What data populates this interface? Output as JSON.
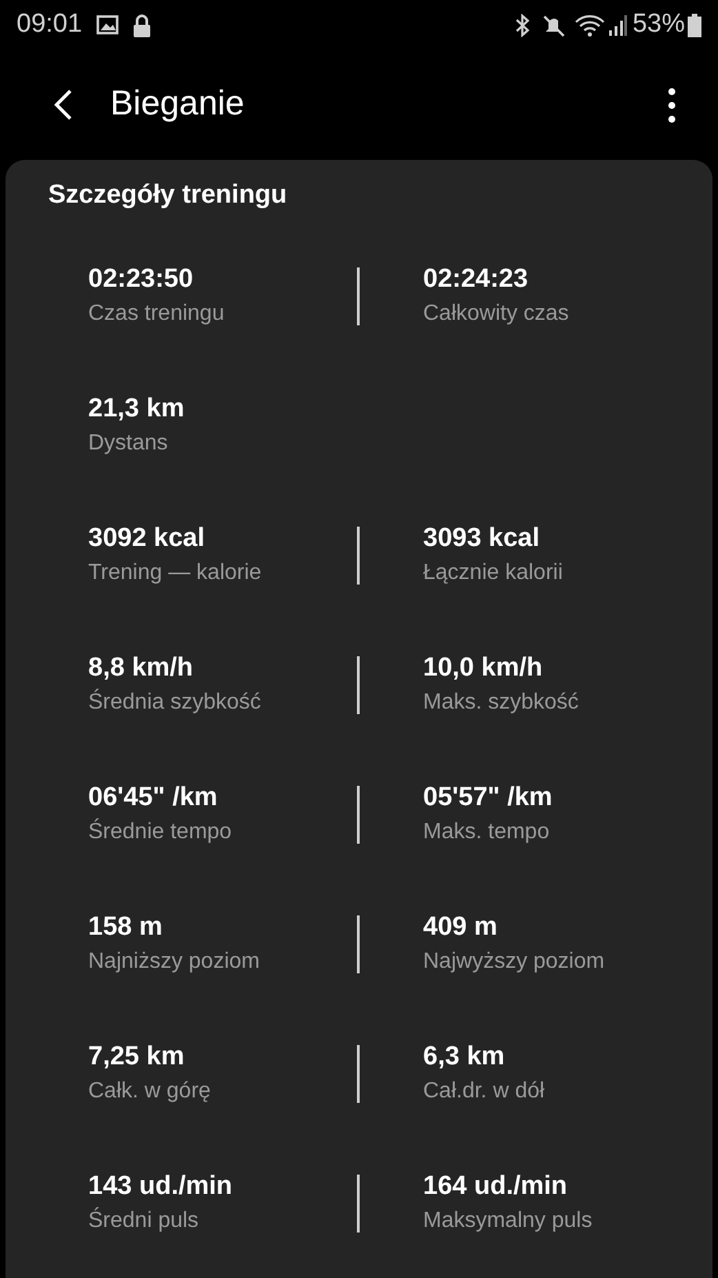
{
  "status_bar": {
    "time": "09:01",
    "battery": "53%"
  },
  "app_bar": {
    "title": "Bieganie"
  },
  "section": {
    "title": "Szczegóły treningu",
    "rows": [
      {
        "left": {
          "value": "02:23:50",
          "label": "Czas treningu"
        },
        "right": {
          "value": "02:24:23",
          "label": "Całkowity czas"
        }
      },
      {
        "left": {
          "value": "21,3 km",
          "label": "Dystans"
        }
      },
      {
        "left": {
          "value": "3092 kcal",
          "label": "Trening — kalorie"
        },
        "right": {
          "value": "3093 kcal",
          "label": "Łącznie kalorii"
        }
      },
      {
        "left": {
          "value": "8,8 km/h",
          "label": "Średnia szybkość"
        },
        "right": {
          "value": "10,0 km/h",
          "label": "Maks. szybkość"
        }
      },
      {
        "left": {
          "value": "06'45\" /km",
          "label": "Średnie tempo"
        },
        "right": {
          "value": "05'57\" /km",
          "label": "Maks. tempo"
        }
      },
      {
        "left": {
          "value": "158 m",
          "label": "Najniższy poziom"
        },
        "right": {
          "value": "409 m",
          "label": "Najwyższy poziom"
        }
      },
      {
        "left": {
          "value": "7,25 km",
          "label": "Całk. w górę"
        },
        "right": {
          "value": "6,3 km",
          "label": "Cał.dr. w dół"
        }
      },
      {
        "left": {
          "value": "143 ud./min",
          "label": "Średni puls"
        },
        "right": {
          "value": "164 ud./min",
          "label": "Maksymalny puls"
        }
      }
    ]
  }
}
